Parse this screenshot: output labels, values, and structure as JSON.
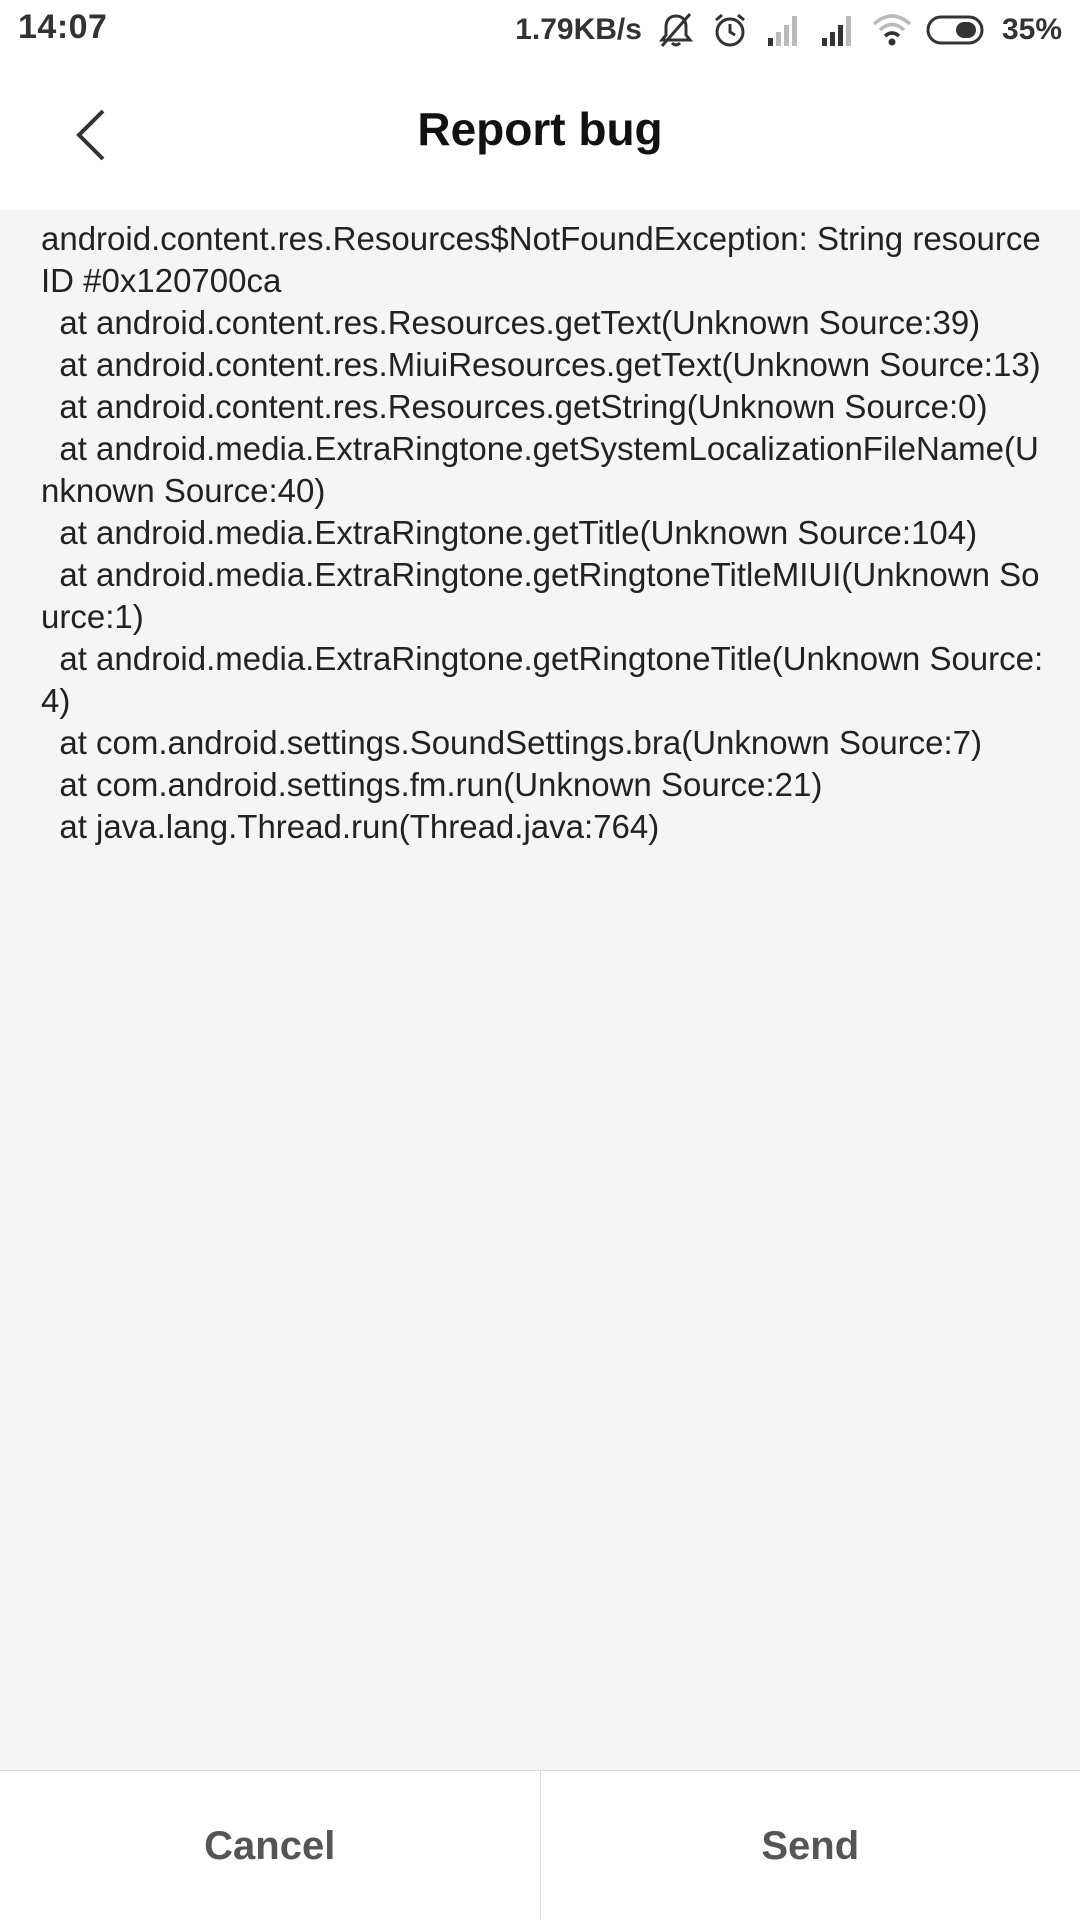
{
  "status_bar": {
    "time": "14:07",
    "network_speed": "1.79KB/s",
    "battery_percent": "35%",
    "icons": [
      "mute-bell-icon",
      "alarm-icon",
      "signal-weak-icon",
      "signal-icon",
      "wifi-icon",
      "battery-icon"
    ]
  },
  "header": {
    "title": "Report bug",
    "back_icon": "chevron-left-icon"
  },
  "content": {
    "bug_report": "android.content.res.Resources$NotFoundException: String resource ID #0x120700ca\n  at android.content.res.Resources.getText(Unknown Source:39)\n  at android.content.res.MiuiResources.getText(Unknown Source:13)\n  at android.content.res.Resources.getString(Unknown Source:0)\n  at android.media.ExtraRingtone.getSystemLocalizationFileName(Unknown Source:40)\n  at android.media.ExtraRingtone.getTitle(Unknown Source:104)\n  at android.media.ExtraRingtone.getRingtoneTitleMIUI(Unknown Source:1)\n  at android.media.ExtraRingtone.getRingtoneTitle(Unknown Source:4)\n  at com.android.settings.SoundSettings.bra(Unknown Source:7)\n  at com.android.settings.fm.run(Unknown Source:21)\n  at java.lang.Thread.run(Thread.java:764)"
  },
  "actions": {
    "cancel_label": "Cancel",
    "send_label": "Send"
  },
  "colors": {
    "background": "#f5f5f5",
    "surface": "#ffffff",
    "text_primary": "#222222",
    "button_text": "#555555",
    "divider": "#dddddd"
  }
}
